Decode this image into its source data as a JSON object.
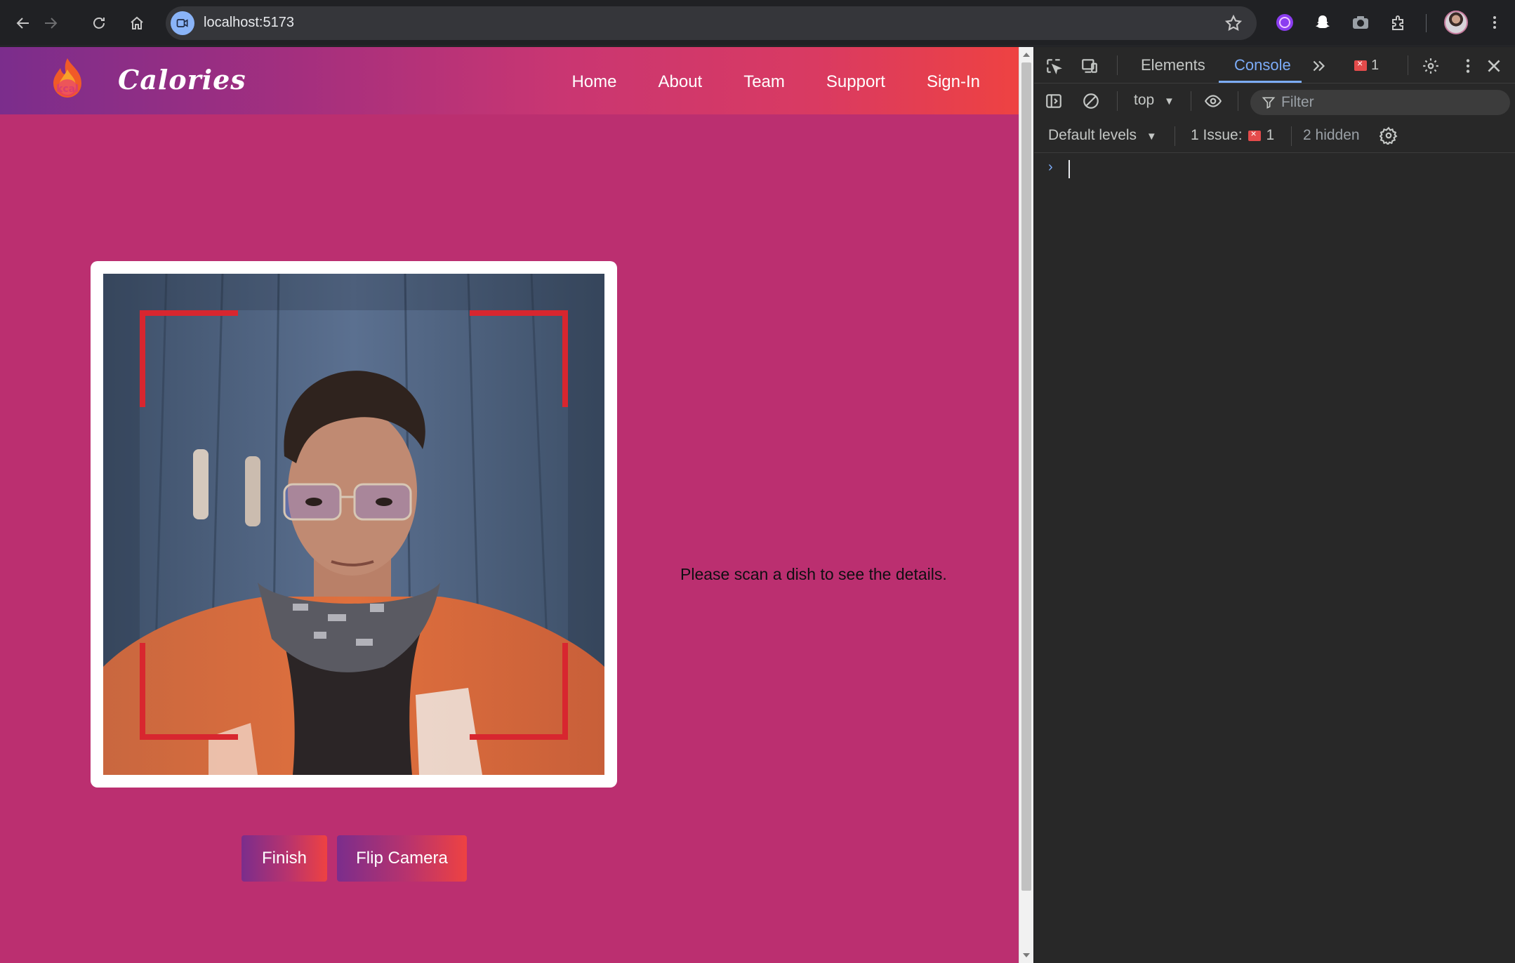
{
  "browser": {
    "url": "localhost:5173",
    "icons": [
      "back-icon",
      "forward-icon",
      "reload-icon",
      "home-icon",
      "site-info-icon",
      "bookmark-star-icon",
      "extension-icon",
      "snapchat-icon",
      "camera-icon",
      "puzzle-extensions-icon",
      "profile-avatar",
      "menu-kebab-icon"
    ]
  },
  "app": {
    "brand": "Calories",
    "logo_text": "kcal",
    "nav": [
      {
        "label": "Home"
      },
      {
        "label": "About"
      },
      {
        "label": "Team"
      },
      {
        "label": "Support"
      },
      {
        "label": "Sign-In"
      }
    ],
    "scan_message": "Please scan a dish to see the details.",
    "buttons": {
      "finish": "Finish",
      "flip": "Flip Camera"
    },
    "colors": {
      "page_background": "#bb2f70",
      "header_gradient_start": "#7b2d8c",
      "header_gradient_end": "#ee4242",
      "scan_corner": "#d8262f"
    }
  },
  "devtools": {
    "tabs": {
      "elements": "Elements",
      "console": "Console"
    },
    "error_count": "1",
    "context": "top",
    "filter_placeholder": "Filter",
    "levels": "Default levels",
    "issues_label": "1 Issue:",
    "issues_count": "1",
    "hidden": "2 hidden"
  }
}
